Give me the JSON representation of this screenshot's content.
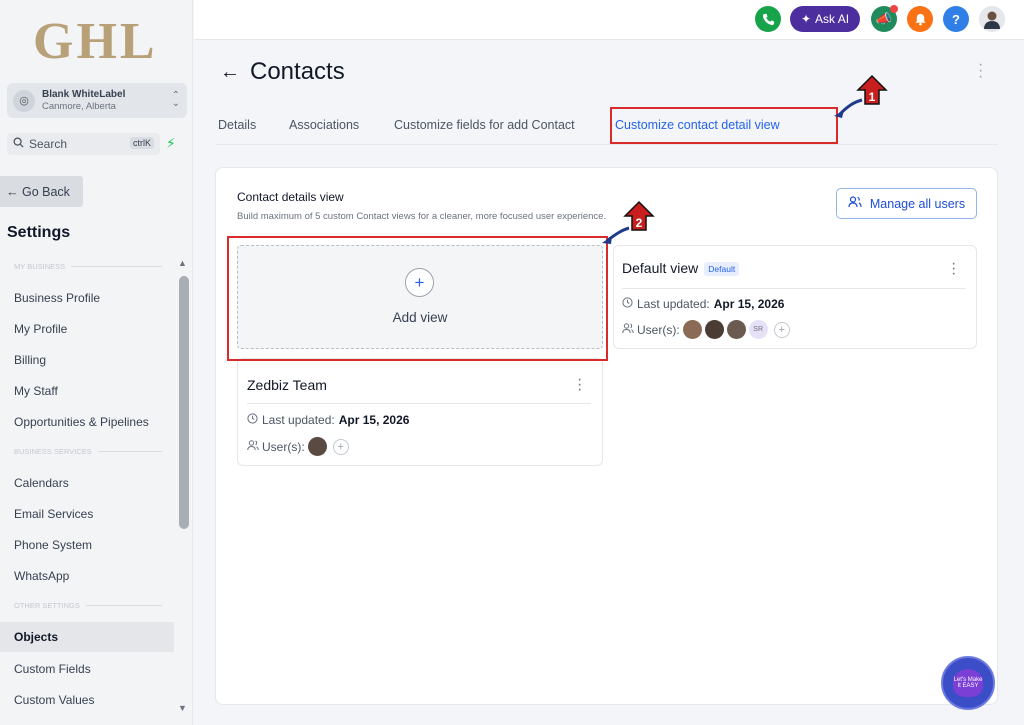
{
  "sidebar": {
    "logo_text": "GHL",
    "location": {
      "name": "Blank WhiteLabel",
      "city": "Canmore, Alberta"
    },
    "search": {
      "label": "Search",
      "shortcut": "ctrlK"
    },
    "go_back": "← Go Back",
    "settings_title": "Settings",
    "sections": {
      "my_business": "MY BUSINESS",
      "business_services": "BUSINESS SERVICES",
      "other_settings": "OTHER SETTINGS"
    },
    "items": {
      "business_profile": "Business Profile",
      "my_profile": "My Profile",
      "billing": "Billing",
      "my_staff": "My Staff",
      "opportunities": "Opportunities & Pipelines",
      "calendars": "Calendars",
      "email_services": "Email Services",
      "phone_system": "Phone System",
      "whatsapp": "WhatsApp",
      "objects": "Objects",
      "custom_fields": "Custom Fields",
      "custom_values": "Custom Values"
    }
  },
  "topbar": {
    "ask_ai": "Ask AI",
    "help": "?"
  },
  "header": {
    "title": "Contacts",
    "tabs": {
      "details": "Details",
      "associations": "Associations",
      "customize_fields": "Customize fields for add Contact",
      "customize_view": "Customize contact detail view"
    }
  },
  "contact_details": {
    "title": "Contact details view",
    "subtitle": "Build maximum of 5 custom Contact views for a cleaner, more focused user experience.",
    "manage_button": "Manage all users",
    "add_view": {
      "plus": "+",
      "label": "Add view"
    },
    "views": {
      "default": {
        "name": "Default view",
        "badge": "Default",
        "updated_label": "Last updated:",
        "updated_date": "Apr 15, 2026",
        "users_label": "User(s):",
        "extra_user_initials": "SR"
      },
      "zedbiz": {
        "name": "Zedbiz Team",
        "updated_label": "Last updated:",
        "updated_date": "Apr 15, 2026",
        "users_label": "User(s):"
      }
    }
  },
  "annotations": {
    "step1": "1",
    "step2": "2",
    "helper_badge": "Let's Make It EASY"
  },
  "colors": {
    "accent": "#2563eb",
    "annotation_red": "#d92b2b",
    "logo_gold": "#b8a078",
    "ask_ai_purple": "#4c2e9e"
  }
}
